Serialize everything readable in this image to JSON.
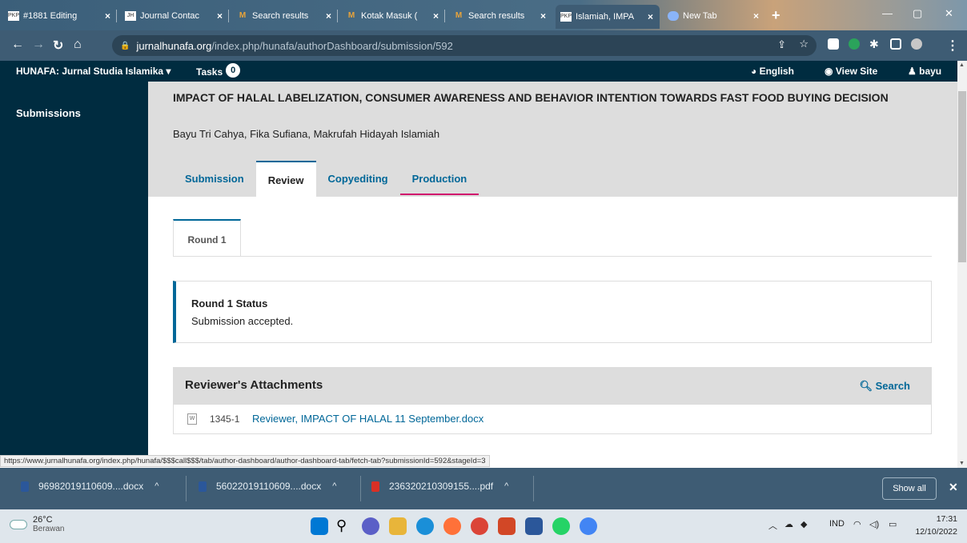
{
  "browser": {
    "tabs": [
      {
        "favicon": "PKP",
        "title": "#1881 Editing"
      },
      {
        "favicon": "JH",
        "title": "Journal Contac"
      },
      {
        "favicon": "M",
        "title": "Search results"
      },
      {
        "favicon": "M",
        "title": "Kotak Masuk ("
      },
      {
        "favicon": "M",
        "title": "Search results"
      },
      {
        "favicon": "PKP",
        "title": "Islamiah, IMPA"
      },
      {
        "favicon": "chrome",
        "title": "New Tab"
      }
    ],
    "url_host": "jurnalhunafa.org",
    "url_path": "/index.php/hunafa/authorDashboard/submission/592",
    "status_url": "https://www.jurnalhunafa.org/index.php/hunafa/$$$call$$$/tab/author-dashboard/author-dashboard-tab/fetch-tab?submissionId=592&stageId=3"
  },
  "app": {
    "journal": "HUNAFA: Jurnal Studia Islamika",
    "tasks_label": "Tasks",
    "tasks_count": "0",
    "language": "English",
    "view_site": "View Site",
    "user": "bayu",
    "sidebar_item": "Submissions"
  },
  "submission": {
    "title": "IMPACT OF HALAL LABELIZATION, CONSUMER AWARENESS AND BEHAVIOR INTENTION TOWARDS FAST FOOD BUYING DECISION",
    "authors": "Bayu Tri Cahya, Fika Sufiana, Makrufah Hidayah Islamiah",
    "tabs": [
      "Submission",
      "Review",
      "Copyediting",
      "Production"
    ],
    "round_tab": "Round 1",
    "status_heading": "Round 1 Status",
    "status_text": "Submission accepted.",
    "attachments_heading": "Reviewer's Attachments",
    "search_label": "Search",
    "file_id": "1345-1",
    "file_name": "Reviewer, IMPACT OF HALAL 11 September.docx"
  },
  "downloads": {
    "items": [
      {
        "name": "96982019110609....docx",
        "type": "word"
      },
      {
        "name": "56022019110609....docx",
        "type": "word"
      },
      {
        "name": "236320210309155....pdf",
        "type": "pdf"
      }
    ],
    "show_all": "Show all"
  },
  "taskbar": {
    "temp": "26°C",
    "weather": "Berawan",
    "lang": "IND",
    "time": "17:31",
    "date": "12/10/2022"
  },
  "colors": {
    "brand_dark": "#002c40",
    "link": "#006798",
    "accent_pink": "#d00a6c"
  }
}
